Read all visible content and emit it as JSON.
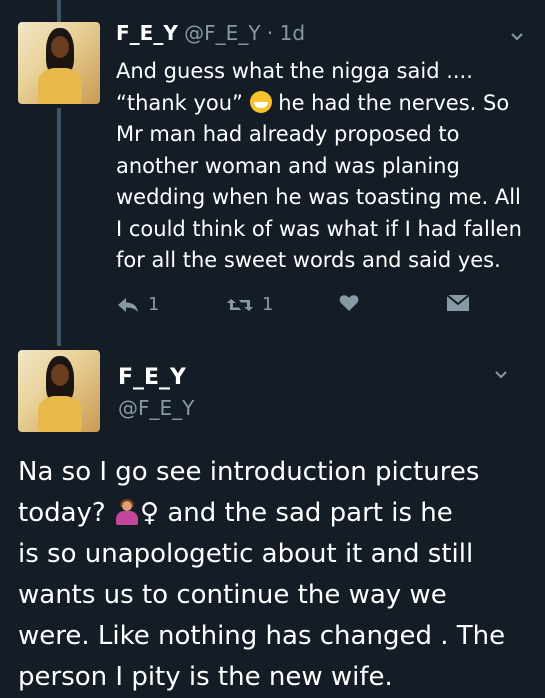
{
  "tweet1": {
    "name": "F_E_Y",
    "handle": "@F_E_Y",
    "separator": "·",
    "age": "1d",
    "lines": [
      "And guess what the nigga said ....",
      "“thank you”",
      "he had the nerves. So",
      "Mr man had already proposed to",
      "another woman and was planing",
      "wedding when he was toasting me. All",
      "I could think of was what if I had fallen",
      "for all the sweet words and said yes."
    ],
    "reply_count": "1",
    "retweet_count": "1",
    "emoji_icon": "grinning-squinting-face-icon"
  },
  "tweet2": {
    "name": "F_E_Y",
    "handle": "@F_E_Y",
    "lines": [
      "Na so I go see introduction pictures",
      "today?",
      "and the sad part is he",
      "is so unapologetic about it and still",
      "wants us to continue the way we",
      "were. Like nothing has changed . The",
      "person I pity is the new wife."
    ],
    "female_sign": "♀",
    "emoji_icon": "woman-shrugging-icon"
  },
  "colors": {
    "background": "#141d26",
    "secondary_text": "#8899a6",
    "thread_line": "#3d5466"
  }
}
